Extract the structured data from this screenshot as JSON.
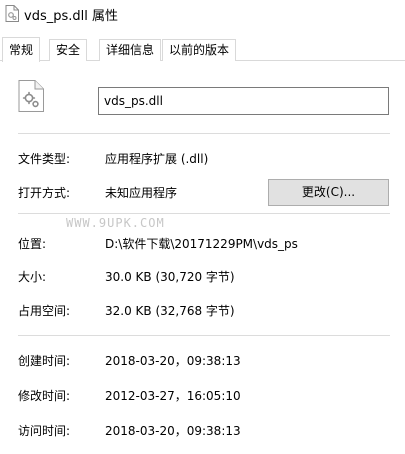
{
  "window": {
    "title": "vds_ps.dll 属性",
    "icon": "dll-file-icon"
  },
  "tabs": [
    {
      "label": "常规",
      "active": true
    },
    {
      "label": "安全",
      "active": false
    },
    {
      "label": "详细信息",
      "active": false
    },
    {
      "label": "以前的版本",
      "active": false
    }
  ],
  "general": {
    "filename": "vds_ps.dll",
    "file_type_label": "文件类型:",
    "file_type_value": "应用程序扩展 (.dll)",
    "open_with_label": "打开方式:",
    "open_with_value": "未知应用程序",
    "change_button": "更改(C)...",
    "watermark": "WWW.9UPK.COM",
    "location_label": "位置:",
    "location_value": "D:\\软件下载\\20171229PM\\vds_ps",
    "size_label": "大小:",
    "size_value": "30.0 KB (30,720 字节)",
    "size_on_disk_label": "占用空间:",
    "size_on_disk_value": "32.0 KB (32,768 字节)",
    "created_label": "创建时间:",
    "created_value": "2018-03-20，09:38:13",
    "modified_label": "修改时间:",
    "modified_value": "2012-03-27，16:05:10",
    "accessed_label": "访问时间:",
    "accessed_value": "2018-03-20，09:38:13"
  }
}
